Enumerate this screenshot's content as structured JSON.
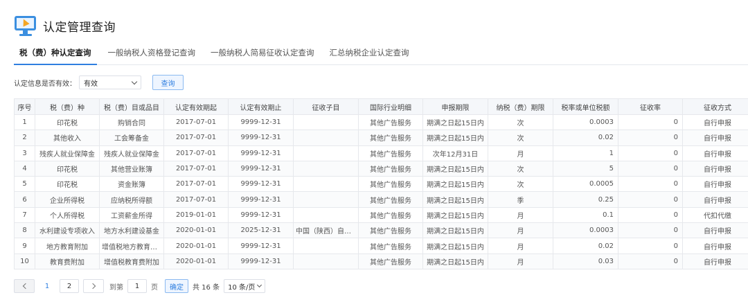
{
  "header": {
    "title": "认定管理查询",
    "icon": "monitor-cursor-icon"
  },
  "tabs": [
    {
      "label": "税（费）种认定查询",
      "active": true
    },
    {
      "label": "一般纳税人资格登记查询",
      "active": false
    },
    {
      "label": "一般纳税人简易征收认定查询",
      "active": false
    },
    {
      "label": "汇总纳税企业认定查询",
      "active": false
    }
  ],
  "filter": {
    "label": "认定信息是否有效：",
    "selected": "有效",
    "query_label": "查询"
  },
  "table": {
    "columns": [
      "序号",
      "税（费）种",
      "税（费）目或品目",
      "认定有效期起",
      "认定有效期止",
      "征收子目",
      "国际行业明细",
      "申报期限",
      "纳税（费）期限",
      "税率或单位税额",
      "征收率",
      "征收方式"
    ],
    "rows": [
      [
        "1",
        "印花税",
        "购销合同",
        "2017-07-01",
        "9999-12-31",
        "",
        "其他广告服务",
        "期满之日起15日内",
        "次",
        "0.0003",
        "0",
        "自行申报"
      ],
      [
        "2",
        "其他收入",
        "工会筹备金",
        "2017-07-01",
        "9999-12-31",
        "",
        "其他广告服务",
        "期满之日起15日内",
        "次",
        "0.02",
        "0",
        "自行申报"
      ],
      [
        "3",
        "残疾人就业保障金",
        "残疾人就业保障金",
        "2017-07-01",
        "9999-12-31",
        "",
        "其他广告服务",
        "次年12月31日",
        "月",
        "1",
        "0",
        "自行申报"
      ],
      [
        "4",
        "印花税",
        "其他营业账簿",
        "2017-07-01",
        "9999-12-31",
        "",
        "其他广告服务",
        "期满之日起15日内",
        "次",
        "5",
        "0",
        "自行申报"
      ],
      [
        "5",
        "印花税",
        "资金账簿",
        "2017-07-01",
        "9999-12-31",
        "",
        "其他广告服务",
        "期满之日起15日内",
        "次",
        "0.0005",
        "0",
        "自行申报"
      ],
      [
        "6",
        "企业所得税",
        "应纳税所得额",
        "2017-07-01",
        "9999-12-31",
        "",
        "其他广告服务",
        "期满之日起15日内",
        "季",
        "0.25",
        "0",
        "自行申报"
      ],
      [
        "7",
        "个人所得税",
        "工资薪金所得",
        "2019-01-01",
        "9999-12-31",
        "",
        "其他广告服务",
        "期满之日起15日内",
        "月",
        "0.1",
        "0",
        "代扣代缴"
      ],
      [
        "8",
        "水利建设专项收入",
        "地方水利建设基金",
        "2020-01-01",
        "2025-12-31",
        "中国（陕西）自贸...",
        "其他广告服务",
        "期满之日起15日内",
        "月",
        "0.0003",
        "0",
        "自行申报"
      ],
      [
        "9",
        "地方教育附加",
        "增值税地方教育附加",
        "2020-01-01",
        "9999-12-31",
        "",
        "其他广告服务",
        "期满之日起15日内",
        "月",
        "0.02",
        "0",
        "自行申报"
      ],
      [
        "10",
        "教育费附加",
        "增值税教育费附加",
        "2020-01-01",
        "9999-12-31",
        "",
        "其他广告服务",
        "期满之日起15日内",
        "月",
        "0.03",
        "0",
        "自行申报"
      ]
    ]
  },
  "pagination": {
    "current_page": "1",
    "next_page": "2",
    "goto_prefix": "到第",
    "goto_value": "1",
    "goto_suffix": "页",
    "confirm_label": "确定",
    "total_text": "共 16 条",
    "page_size": "10 条/页"
  },
  "colors": {
    "accent": "#2f7fe0",
    "icon_orange": "#f5a623"
  }
}
